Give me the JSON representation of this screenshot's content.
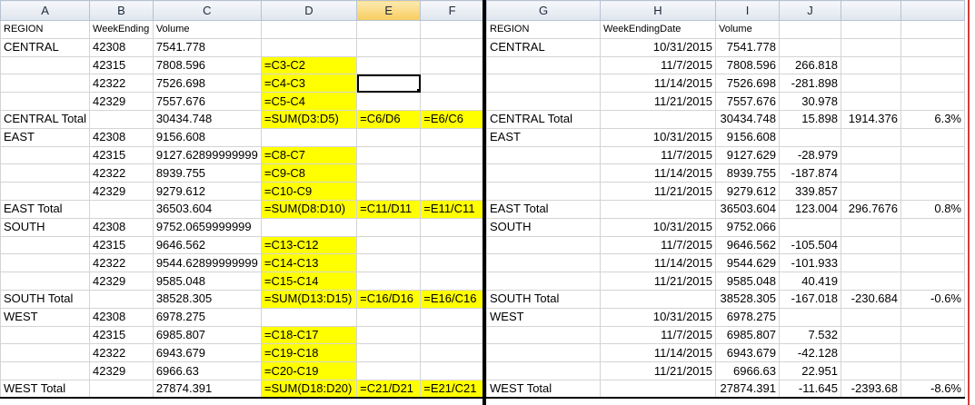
{
  "left": {
    "columns": [
      "A",
      "B",
      "C",
      "D",
      "E",
      "F"
    ],
    "selected_column": "E",
    "rows": [
      {
        "type": "header",
        "cells": [
          "REGION",
          "WeekEnding",
          "Volume",
          "",
          "",
          ""
        ]
      },
      {
        "type": "data",
        "cells": [
          "CENTRAL",
          "42308",
          "7541.778",
          "",
          "",
          ""
        ]
      },
      {
        "type": "data",
        "cells": [
          "",
          "42315",
          "7808.596",
          "=C3-C2",
          "",
          ""
        ]
      },
      {
        "type": "data",
        "cells": [
          "",
          "42322",
          "7526.698",
          "=C4-C3",
          "",
          ""
        ],
        "active": 4
      },
      {
        "type": "data",
        "cells": [
          "",
          "42329",
          "7557.676",
          "=C5-C4",
          "",
          ""
        ]
      },
      {
        "type": "total",
        "cells": [
          "CENTRAL Total",
          "",
          "30434.748",
          "=SUM(D3:D5)",
          "=C6/D6",
          "=E6/C6"
        ]
      },
      {
        "type": "data",
        "cells": [
          "EAST",
          "42308",
          "9156.608",
          "",
          "",
          ""
        ]
      },
      {
        "type": "data",
        "cells": [
          "",
          "42315",
          "9127.62899999999",
          "=C8-C7",
          "",
          ""
        ]
      },
      {
        "type": "data",
        "cells": [
          "",
          "42322",
          "8939.755",
          "=C9-C8",
          "",
          ""
        ]
      },
      {
        "type": "data",
        "cells": [
          "",
          "42329",
          "9279.612",
          "=C10-C9",
          "",
          ""
        ]
      },
      {
        "type": "total",
        "cells": [
          "EAST Total",
          "",
          "36503.604",
          "=SUM(D8:D10)",
          "=C11/D11",
          "=E11/C11"
        ]
      },
      {
        "type": "data",
        "cells": [
          "SOUTH",
          "42308",
          "9752.0659999999",
          "",
          "",
          ""
        ]
      },
      {
        "type": "data",
        "cells": [
          "",
          "42315",
          "9646.562",
          "=C13-C12",
          "",
          ""
        ]
      },
      {
        "type": "data",
        "cells": [
          "",
          "42322",
          "9544.62899999999",
          "=C14-C13",
          "",
          ""
        ]
      },
      {
        "type": "data",
        "cells": [
          "",
          "42329",
          "9585.048",
          "=C15-C14",
          "",
          ""
        ]
      },
      {
        "type": "total",
        "cells": [
          "SOUTH Total",
          "",
          "38528.305",
          "=SUM(D13:D15)",
          "=C16/D16",
          "=E16/C16"
        ]
      },
      {
        "type": "data",
        "cells": [
          "WEST",
          "42308",
          "6978.275",
          "",
          "",
          ""
        ]
      },
      {
        "type": "data",
        "cells": [
          "",
          "42315",
          "6985.807",
          "=C18-C17",
          "",
          ""
        ]
      },
      {
        "type": "data",
        "cells": [
          "",
          "42322",
          "6943.679",
          "=C19-C18",
          "",
          ""
        ]
      },
      {
        "type": "data",
        "cells": [
          "",
          "42329",
          "6966.63",
          "=C20-C19",
          "",
          ""
        ]
      },
      {
        "type": "total",
        "cells": [
          "WEST Total",
          "",
          "27874.391",
          "=SUM(D18:D20)",
          "=C21/D21",
          "=E21/C21"
        ]
      }
    ]
  },
  "right": {
    "columns": [
      "G",
      "H",
      "I",
      "J",
      ""
    ],
    "rows": [
      {
        "type": "header",
        "cells": [
          "REGION",
          "WeekEndingDate",
          "Volume",
          "",
          "",
          ""
        ]
      },
      {
        "type": "data",
        "cells": [
          "CENTRAL",
          "10/31/2015",
          "7541.778",
          "",
          "",
          ""
        ]
      },
      {
        "type": "data",
        "cells": [
          "",
          "11/7/2015",
          "7808.596",
          "266.818",
          "",
          ""
        ]
      },
      {
        "type": "data",
        "cells": [
          "",
          "11/14/2015",
          "7526.698",
          "-281.898",
          "",
          ""
        ]
      },
      {
        "type": "data",
        "cells": [
          "",
          "11/21/2015",
          "7557.676",
          "30.978",
          "",
          ""
        ]
      },
      {
        "type": "total",
        "cells": [
          "CENTRAL Total",
          "",
          "30434.748",
          "15.898",
          "1914.376",
          "6.3%"
        ]
      },
      {
        "type": "data",
        "cells": [
          "EAST",
          "10/31/2015",
          "9156.608",
          "",
          "",
          ""
        ]
      },
      {
        "type": "data",
        "cells": [
          "",
          "11/7/2015",
          "9127.629",
          "-28.979",
          "",
          ""
        ]
      },
      {
        "type": "data",
        "cells": [
          "",
          "11/14/2015",
          "8939.755",
          "-187.874",
          "",
          ""
        ]
      },
      {
        "type": "data",
        "cells": [
          "",
          "11/21/2015",
          "9279.612",
          "339.857",
          "",
          ""
        ]
      },
      {
        "type": "total",
        "cells": [
          "EAST Total",
          "",
          "36503.604",
          "123.004",
          "296.7676",
          "0.8%"
        ]
      },
      {
        "type": "data",
        "cells": [
          "SOUTH",
          "10/31/2015",
          "9752.066",
          "",
          "",
          ""
        ]
      },
      {
        "type": "data",
        "cells": [
          "",
          "11/7/2015",
          "9646.562",
          "-105.504",
          "",
          ""
        ]
      },
      {
        "type": "data",
        "cells": [
          "",
          "11/14/2015",
          "9544.629",
          "-101.933",
          "",
          ""
        ]
      },
      {
        "type": "data",
        "cells": [
          "",
          "11/21/2015",
          "9585.048",
          "40.419",
          "",
          ""
        ]
      },
      {
        "type": "total",
        "cells": [
          "SOUTH Total",
          "",
          "38528.305",
          "-167.018",
          "-230.684",
          "-0.6%"
        ]
      },
      {
        "type": "data",
        "cells": [
          "WEST",
          "10/31/2015",
          "6978.275",
          "",
          "",
          ""
        ]
      },
      {
        "type": "data",
        "cells": [
          "",
          "11/7/2015",
          "6985.807",
          "7.532",
          "",
          ""
        ]
      },
      {
        "type": "data",
        "cells": [
          "",
          "11/14/2015",
          "6943.679",
          "-42.128",
          "",
          ""
        ]
      },
      {
        "type": "data",
        "cells": [
          "",
          "11/21/2015",
          "6966.63",
          "22.951",
          "",
          ""
        ]
      },
      {
        "type": "total",
        "cells": [
          "WEST Total",
          "",
          "27874.391",
          "-11.645",
          "-2393.68",
          "-8.6%"
        ]
      }
    ]
  },
  "colors": {
    "formula_fill": "#ffff00",
    "selected_header": "#f7cd5e",
    "window_edge": "#d33c3c"
  }
}
